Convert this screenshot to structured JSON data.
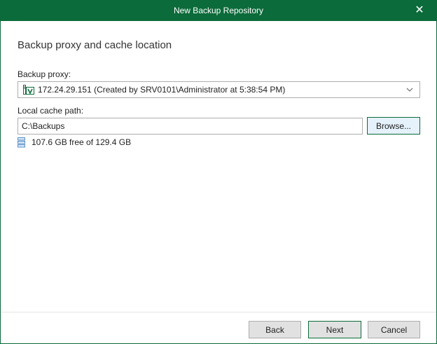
{
  "window": {
    "title": "New Backup Repository"
  },
  "page": {
    "heading": "Backup proxy and cache location"
  },
  "proxy": {
    "label": "Backup proxy:",
    "selected": "172.24.29.151 (Created by SRV0101\\Administrator at 5:38:54 PM)"
  },
  "cache": {
    "label": "Local cache path:",
    "value": "C:\\Backups",
    "browse_label": "Browse...",
    "free_space": "107.6 GB free of 129.4 GB"
  },
  "footer": {
    "back_label": "Back",
    "next_label": "Next",
    "cancel_label": "Cancel"
  },
  "colors": {
    "accent": "#0b6b3a",
    "title_text": "#ffffff"
  },
  "icons": {
    "close": "close-icon",
    "server": "veeam-server-icon",
    "dropdown": "chevron-down-icon",
    "disk": "disk-icon"
  }
}
